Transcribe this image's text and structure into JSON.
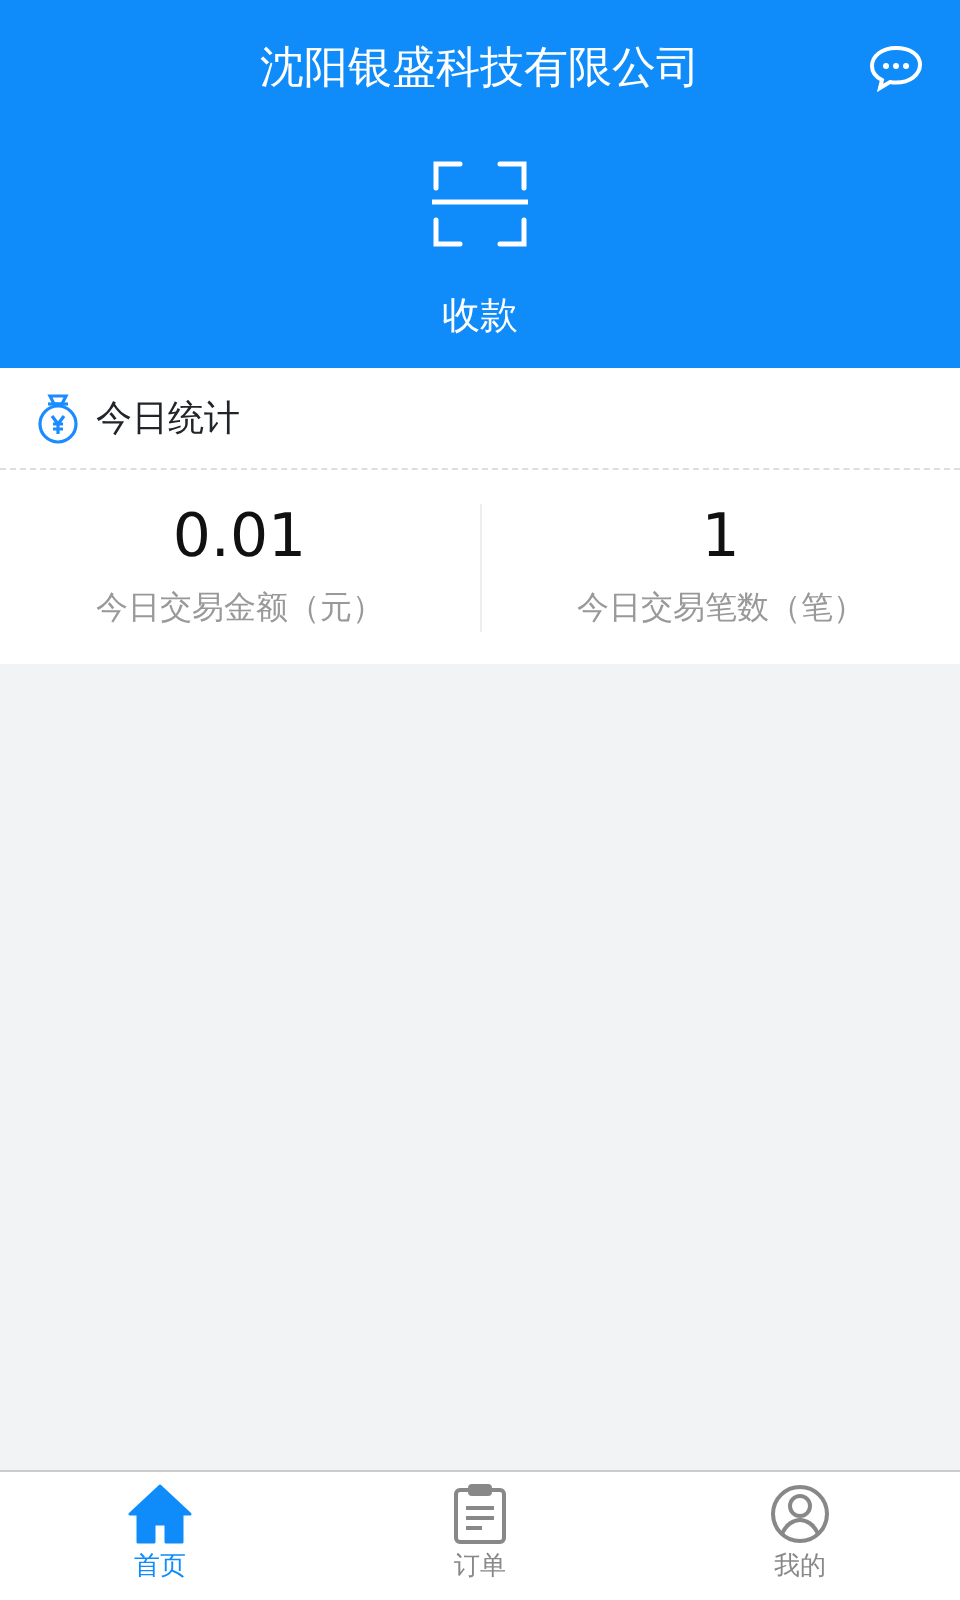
{
  "header": {
    "title": "沈阳银盛科技有限公司",
    "action_label": "收款"
  },
  "stats": {
    "title": "今日统计",
    "items": [
      {
        "value": "0.01",
        "label": "今日交易金额（元）"
      },
      {
        "value": "1",
        "label": "今日交易笔数（笔）"
      }
    ]
  },
  "tabs": [
    {
      "kind": "home",
      "label": "首页",
      "selected": true
    },
    {
      "kind": "orders",
      "label": "订单",
      "selected": false
    },
    {
      "kind": "profile",
      "label": "我的",
      "selected": false
    }
  ]
}
